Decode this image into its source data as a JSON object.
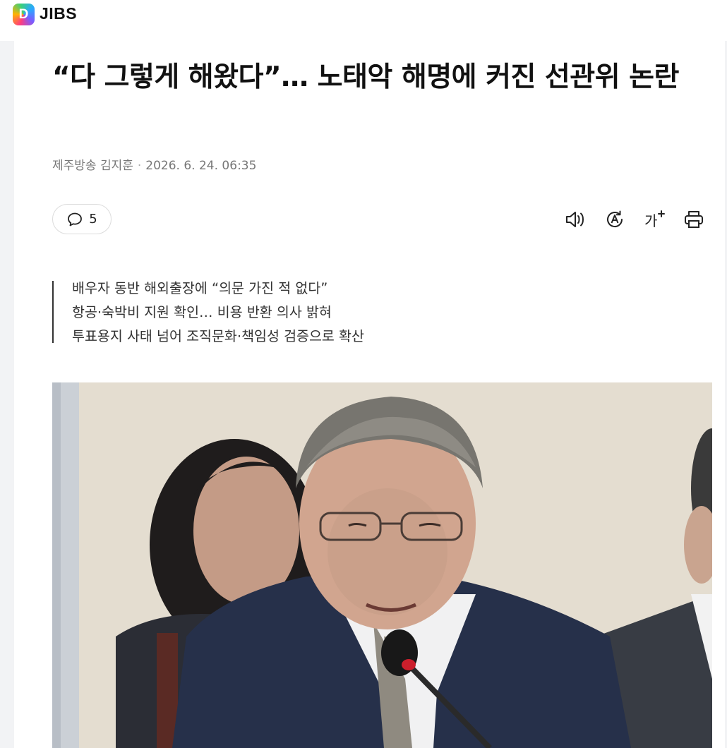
{
  "brand": {
    "logo_letter": "D",
    "name": "JIBS"
  },
  "article": {
    "headline": "“다 그렇게 해왔다”… 노태악 해명에 커진 선관위 논란",
    "outlet": "제주방송 김지훈",
    "datetime": "2026. 6. 24. 06:35",
    "comment_count": "5",
    "summary": [
      "배우자 동반 해외출장에 “의문 가진 적 없다”",
      "항공·숙박비 지원 확인… 비용 반환 의사 밝혀",
      "투표용지 사태 넘어 조직문화·책임성 검증으로 확산"
    ]
  },
  "toolbar": {
    "icons": [
      "speaker-icon",
      "translate-icon",
      "font-size-icon",
      "print-icon"
    ],
    "font_size_glyph": "가"
  },
  "colors": {
    "suit": "#26304a",
    "background": "#ffffff",
    "muted_text": "#777777"
  }
}
